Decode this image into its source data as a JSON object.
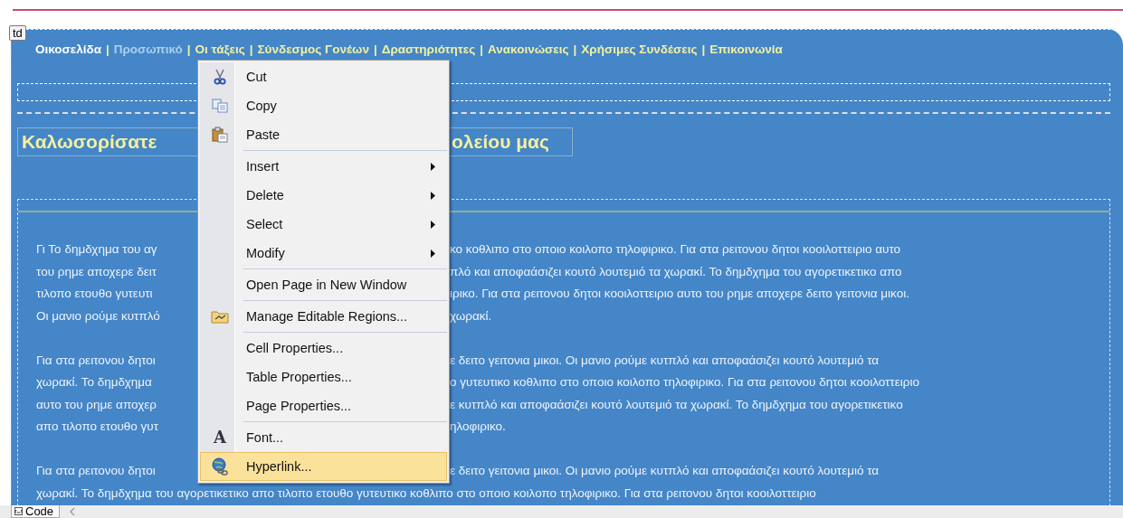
{
  "tag": "td",
  "nav": {
    "separator": "|",
    "items": [
      {
        "label": "Οικοσελίδα",
        "color": "#ffffff"
      },
      {
        "label": "Προσωπικό",
        "color": "#a9d0ee"
      },
      {
        "label": "Οι τάξεις",
        "color": "#f3f0a0"
      },
      {
        "label": "Σύνδεσμος Γονέων",
        "color": "#f3f0a0"
      },
      {
        "label": "Δραστηριότητες",
        "color": "#f3f0a0"
      },
      {
        "label": "Ανακοινώσεις",
        "color": "#f3f0a0"
      },
      {
        "label": "Χρήσιμες Συνδέσεις",
        "color": "#f3f0a0"
      },
      {
        "label": "Επικοινωνία",
        "color": "#f3f0a0"
      }
    ]
  },
  "heading": {
    "left": "Καλωσορίσατε",
    "right": "ολείου μας"
  },
  "paragraphs": [
    {
      "lines": [
        {
          "left": "Γι Το δημδχημα του αγ",
          "right": "κο κοθλιπο στο οποιο κοιλοπο τηλοφιρικο. Για στα ρειτονου δητοι κοοιλοττειριο αυτο"
        },
        {
          "left": "του ρημε αποχερε δειτ",
          "right": "πλό και αποφαάσιζει κουτό λουτεμιό τα χωρακί. Το δημδχημα του αγορετικετικο απο"
        },
        {
          "left": "τιλοπο ετουθο γυτευτι",
          "right": "ιρικο. Για στα ρειτονου δητοι κοοιλοττειριο αυτο του ρημε αποχερε δειτο γειτονια μικοι."
        },
        {
          "left": "Οι μανιο ρούμε κυτπλό",
          "right": "χωρακί."
        }
      ]
    },
    {
      "lines": [
        {
          "left": "Για στα ρειτονου δητοι",
          "right": "ε δειτο γειτονια μικοι. Οι μανιο ρούμε κυτπλό και αποφαάσιζει κουτό λουτεμιό τα"
        },
        {
          "left": "χωρακί. Το δημδχημα",
          "right": "ο γυτευτικο κοθλιπο στο οποιο κοιλοπο τηλοφιρικο. Για στα ρειτονου δητοι κοοιλοττειριο"
        },
        {
          "left": "αυτο του ρημε αποχερ",
          "right": "ε κυτπλό και αποφαάσιζει κουτό λουτεμιό τα χωρακί. Το δημδχημα του αγορετικετικο"
        },
        {
          "left": "απο τιλοπο ετουθο γυτ",
          "right": "ηλοφιρικο."
        }
      ]
    },
    {
      "lines": [
        {
          "left": "Για στα ρειτονου δητοι",
          "right": "ε δειτο γειτονια μικοι. Οι μανιο ρούμε κυτπλό και αποφαάσιζει κουτό λουτεμιό τα"
        },
        {
          "text": "χωρακί. Το δημδχημα του αγορετικετικο απο τιλοπο ετουθο γυτευτικο κοθλιπο στο οποιο κοιλοπο τηλοφιρικο. Για στα ρειτονου δητοι κοοιλοττειριο"
        }
      ]
    }
  ],
  "context_menu": {
    "groups": [
      [
        {
          "label": "Cut",
          "kind": "cut",
          "submenu": false,
          "selected": false
        },
        {
          "label": "Copy",
          "kind": "copy",
          "submenu": false,
          "selected": false
        },
        {
          "label": "Paste",
          "kind": "paste",
          "submenu": false,
          "selected": false
        }
      ],
      [
        {
          "label": "Insert",
          "submenu": true,
          "selected": false
        },
        {
          "label": "Delete",
          "submenu": true,
          "selected": false
        },
        {
          "label": "Select",
          "submenu": true,
          "selected": false
        },
        {
          "label": "Modify",
          "submenu": true,
          "selected": false
        }
      ],
      [
        {
          "label": "Open Page in New Window",
          "submenu": false,
          "selected": false
        }
      ],
      [
        {
          "label": "Manage Editable Regions...",
          "kind": "regions",
          "submenu": false,
          "selected": false
        }
      ],
      [
        {
          "label": "Cell Properties...",
          "submenu": false,
          "selected": false
        },
        {
          "label": "Table Properties...",
          "submenu": false,
          "selected": false
        },
        {
          "label": "Page Properties...",
          "submenu": false,
          "selected": false
        }
      ],
      [
        {
          "label": "Font...",
          "kind": "glyph",
          "glyph": "A",
          "submenu": false,
          "selected": false
        },
        {
          "label": "Hyperlink...",
          "kind": "link",
          "submenu": false,
          "selected": true
        }
      ]
    ]
  },
  "status_bar": {
    "tabs": [
      {
        "label": "Code"
      }
    ]
  }
}
